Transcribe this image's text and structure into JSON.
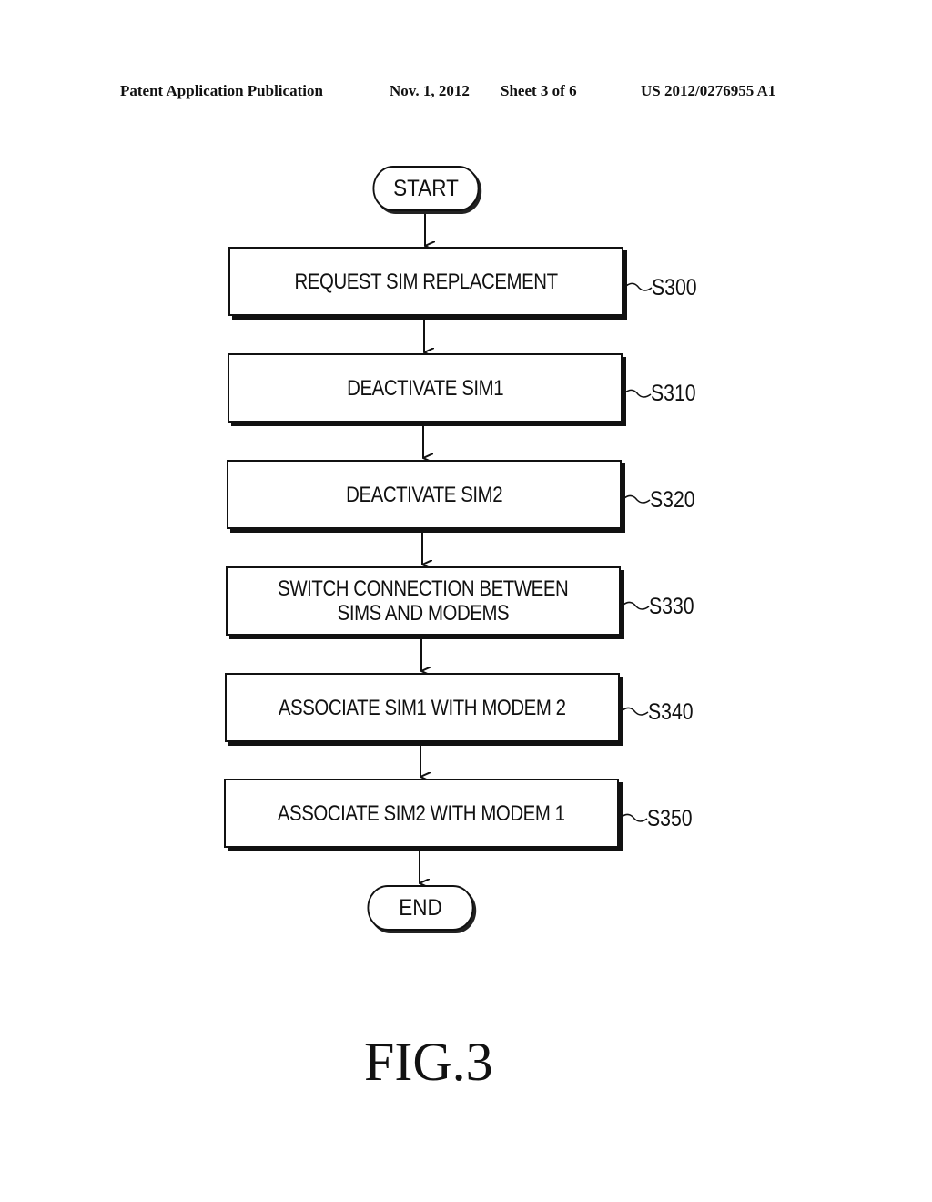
{
  "header": {
    "publication": "Patent Application Publication",
    "date": "Nov. 1, 2012",
    "sheet": "Sheet 3 of 6",
    "number": "US 2012/0276955 A1"
  },
  "flowchart": {
    "start": "START",
    "end": "END",
    "steps": [
      {
        "id": "S300",
        "lines": [
          "REQUEST SIM REPLACEMENT"
        ]
      },
      {
        "id": "S310",
        "lines": [
          "DEACTIVATE SIM1"
        ]
      },
      {
        "id": "S320",
        "lines": [
          "DEACTIVATE SIM2"
        ]
      },
      {
        "id": "S330",
        "lines": [
          "SWITCH CONNECTION BETWEEN",
          "SIMS AND MODEMS"
        ]
      },
      {
        "id": "S340",
        "lines": [
          "ASSOCIATE SIM1 WITH MODEM 2"
        ]
      },
      {
        "id": "S350",
        "lines": [
          "ASSOCIATE SIM2 WITH MODEM 1"
        ]
      }
    ]
  },
  "figure_label": "FIG.3"
}
